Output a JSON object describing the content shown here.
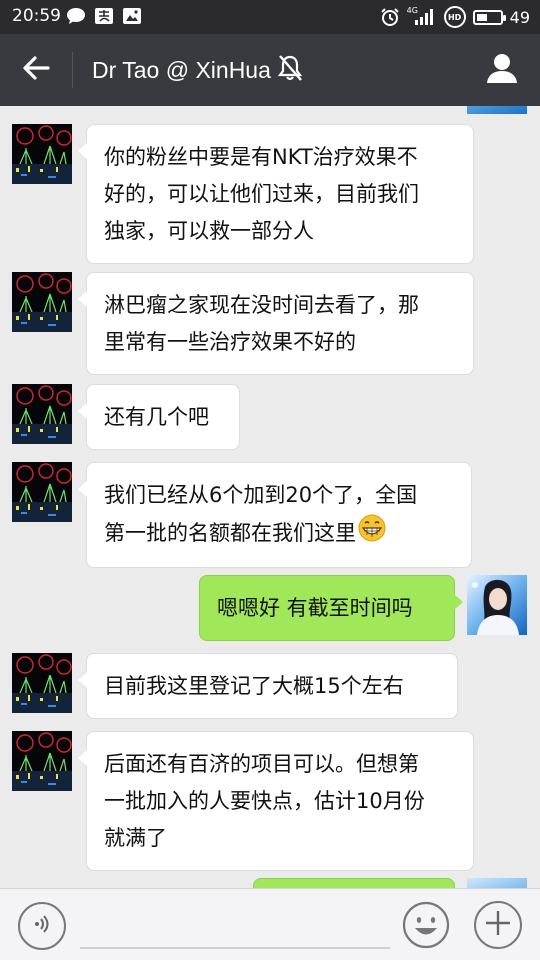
{
  "status_bar": {
    "time": "20:59",
    "network": "4G",
    "hd": "HD",
    "battery": "49",
    "battery_level": 0.49,
    "icons": [
      "chat-bubble-icon",
      "alipay-icon",
      "image-message-icon",
      "alarm-icon",
      "signal-icon",
      "hd-icon",
      "battery-icon"
    ]
  },
  "header": {
    "title": "Dr Tao @ XinHua",
    "back_icon": "back-arrow-icon",
    "mute_icon": "mute-bell-icon",
    "profile_icon": "profile-icon"
  },
  "messages": [
    {
      "side": "in",
      "avatar": "fireworks-avatar",
      "lines": [
        "你的粉丝中要是有NKT治疗效果不",
        "好的，可以让他们过来，目前我们",
        "独家，可以救一部分人"
      ]
    },
    {
      "side": "in",
      "avatar": "fireworks-avatar",
      "lines": [
        "淋巴瘤之家现在没时间去看了，那",
        "里常有一些治疗效果不好的"
      ]
    },
    {
      "side": "in",
      "avatar": "fireworks-avatar",
      "lines": [
        "还有几个吧"
      ]
    },
    {
      "side": "in",
      "avatar": "fireworks-avatar",
      "lines": [
        "我们已经从6个加到20个了，全国",
        "第一批的名额都在我们这里"
      ],
      "emoji": "grinning-face-emoji"
    },
    {
      "side": "out",
      "avatar": "girl-avatar",
      "lines": [
        "嗯嗯好 有截至时间吗"
      ]
    },
    {
      "side": "in",
      "avatar": "fireworks-avatar",
      "lines": [
        "目前我这里登记了大概15个左右"
      ]
    },
    {
      "side": "in",
      "avatar": "fireworks-avatar",
      "lines": [
        "后面还有百济的项目可以。但想第",
        "一批加入的人要快点，估计10月份",
        "就满了"
      ]
    }
  ],
  "input_bar": {
    "voice_icon": "voice-icon",
    "text_value": "",
    "emoji_icon": "emoji-face-icon",
    "plus_icon": "plus-icon"
  },
  "colors": {
    "status_bar": "#2b2b2e",
    "header": "#393a3f",
    "chat_bg": "#ebebeb",
    "bubble_in": "#ffffff",
    "bubble_out": "#a0e75a",
    "input_bar": "#f4f4f6"
  }
}
